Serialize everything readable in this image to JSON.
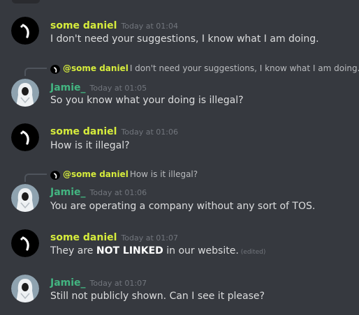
{
  "theme": {
    "background": "#36393f",
    "daniel_color": "#d6ec3c",
    "jamie_color": "#43b581",
    "text_color": "#dcddde",
    "muted_color": "#72767d"
  },
  "messages": [
    {
      "author": "some daniel",
      "avatar_icon": "black-circle-avatar",
      "timestamp": "Today at 01:04",
      "parts": {
        "text": "I don't need your suggestions, I know what I am doing."
      }
    },
    {
      "author": "Jamie_",
      "avatar_icon": "hooded-figure-avatar",
      "timestamp": "Today at 01:05",
      "reply_to": {
        "name": "@some daniel",
        "preview": "I don't need your suggestions, I know what I am doing."
      },
      "parts": {
        "text": "So you know what your doing is illegal?"
      }
    },
    {
      "author": "some daniel",
      "avatar_icon": "black-circle-avatar",
      "timestamp": "Today at 01:06",
      "parts": {
        "text": "How is it illegal?"
      }
    },
    {
      "author": "Jamie_",
      "avatar_icon": "hooded-figure-avatar",
      "timestamp": "Today at 01:06",
      "reply_to": {
        "name": "@some daniel",
        "preview": "How is it illegal?"
      },
      "parts": {
        "text": "You are operating a company without any sort of TOS."
      }
    },
    {
      "author": "some daniel",
      "avatar_icon": "black-circle-avatar",
      "timestamp": "Today at 01:07",
      "parts": {
        "before": "They are ",
        "bold": "NOT LINKED",
        "after": " in our website.",
        "edited": "(edited)"
      }
    },
    {
      "author": "Jamie_",
      "avatar_icon": "hooded-figure-avatar",
      "timestamp": "Today at 01:07",
      "parts": {
        "text": "Still not publicly shown. Can I see it please?"
      }
    }
  ]
}
